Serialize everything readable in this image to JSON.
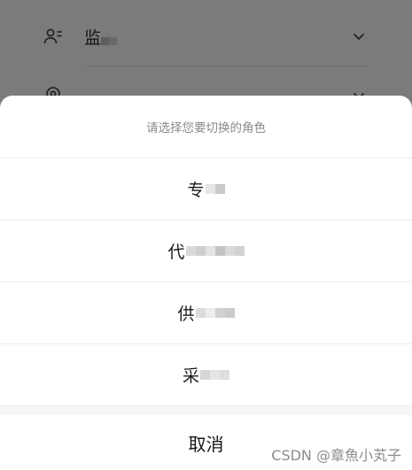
{
  "background": {
    "rows": [
      {
        "icon": "users-icon",
        "label": "监",
        "chevron": "chevron-down-icon"
      },
      {
        "icon": "location-pin-icon",
        "label": "",
        "chevron": "chevron-down-icon"
      }
    ]
  },
  "sheet": {
    "title": "请选择您要切换的角色",
    "options": [
      {
        "label": "专"
      },
      {
        "label": "代"
      },
      {
        "label": "供"
      },
      {
        "label": "采"
      }
    ],
    "cancel_label": "取消"
  },
  "watermark": "CSDN @章魚小芄子",
  "colors": {
    "overlay": "#7b7b7b",
    "sheet_bg": "#ffffff",
    "title_text": "#8a8a8a",
    "divider": "#ececec",
    "band": "#f5f5f5"
  }
}
